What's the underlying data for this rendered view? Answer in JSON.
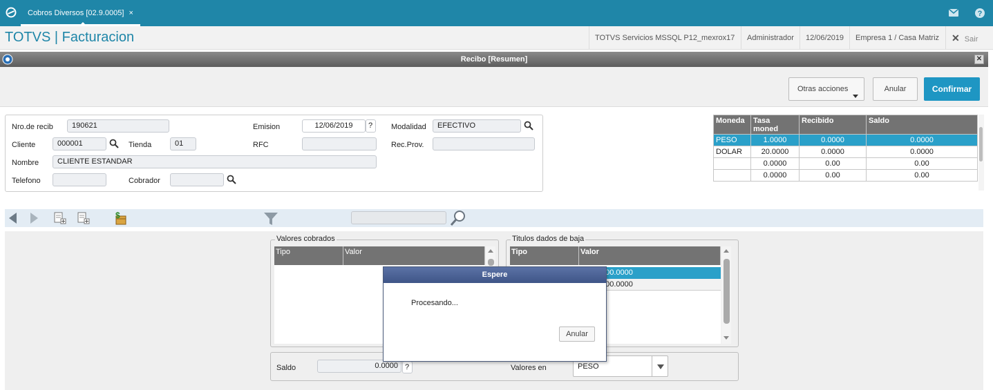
{
  "tabbar": {
    "tab_label": "Cobros Diversos [02.9.0005]",
    "close_glyph": "×"
  },
  "header": {
    "app_title": "TOTVS | Facturacion",
    "server": "TOTVS Servicios MSSQL P12_mexrox17",
    "user": "Administrador",
    "date": "12/06/2019",
    "company": "Empresa 1 / Casa Matriz",
    "exit_label": "Sair"
  },
  "window": {
    "title": "Recibo [Resumen]"
  },
  "actions": {
    "other_label": "Otras acciones",
    "cancel_label": "Anular",
    "confirm_label": "Confirmar"
  },
  "form": {
    "nro_label": "Nro.de recib",
    "nro_value": "190621",
    "emision_label": "Emision",
    "emision_value": "12/06/2019",
    "help_glyph": "?",
    "modalidad_label": "Modalidad",
    "modalidad_value": "EFECTIVO",
    "cliente_label": "Cliente",
    "cliente_value": "000001",
    "tienda_label": "Tienda",
    "tienda_value": "01",
    "rfc_label": "RFC",
    "rfc_value": "",
    "recprov_label": "Rec.Prov.",
    "recprov_value": "",
    "nombre_label": "Nombre",
    "nombre_value": "CLIENTE ESTANDAR",
    "telefono_label": "Telefono",
    "telefono_value": "",
    "cobrador_label": "Cobrador",
    "cobrador_value": ""
  },
  "currency_grid": {
    "headers": [
      "Moneda",
      "Tasa moned",
      "Recibido",
      "Saldo"
    ],
    "rows": [
      [
        "PESO",
        "1.0000",
        "0.0000",
        "0.0000"
      ],
      [
        "DOLAR",
        "20.0000",
        "0.0000",
        "0.0000"
      ],
      [
        "",
        "0.0000",
        "0.00",
        "0.00"
      ],
      [
        "",
        "0.0000",
        "0.00",
        "0.00"
      ]
    ]
  },
  "valores": {
    "title": "Valores cobrados",
    "col_tipo": "Tipo",
    "col_valor": "Valor"
  },
  "titulos": {
    "title": "Titulos dados de baja",
    "col_tipo": "Tipo",
    "col_valor": "Valor",
    "rows": [
      "000.0000",
      "000.0000"
    ]
  },
  "bottom": {
    "saldo_label": "Saldo",
    "saldo_value": "0.0000",
    "valores_en_label": "Valores en",
    "valores_en_value": "PESO"
  },
  "dialog": {
    "title": "Espere",
    "message": "Procesando...",
    "cancel_label": "Anular"
  },
  "colors": {
    "accent": "#1f86a8",
    "confirm": "#1e96c3",
    "selected_row": "#2aa0c9",
    "dialog_title": "#4a5f93"
  }
}
